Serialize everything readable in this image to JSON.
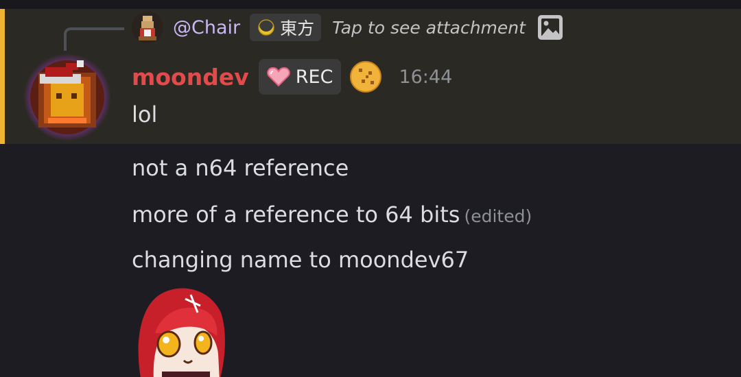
{
  "reply": {
    "username": "@Chair",
    "tag_label": "東方",
    "preview_text": "Tap to see attachment",
    "avatar_icon": "pixel-avatar-icon",
    "attachment_icon": "image-icon"
  },
  "message": {
    "author": "moondev",
    "author_color": "#e24b4b",
    "badge_label": "REC",
    "badge_icon": "heart-icon",
    "decoration_icon": "cookie-icon",
    "timestamp": "16:44",
    "lines": [
      {
        "text": "lol"
      },
      {
        "text": "not a n64 reference"
      },
      {
        "text": "more of a reference to 64 bits",
        "edited": "(edited)"
      },
      {
        "text": "changing name to moondev67"
      }
    ],
    "sticker_icon": "anime-girl-sticker"
  },
  "colors": {
    "highlight_bar": "#f0b232",
    "highlight_bg": "#2b2924",
    "background": "#1c1c22",
    "reply_name": "#c9b8f5"
  }
}
